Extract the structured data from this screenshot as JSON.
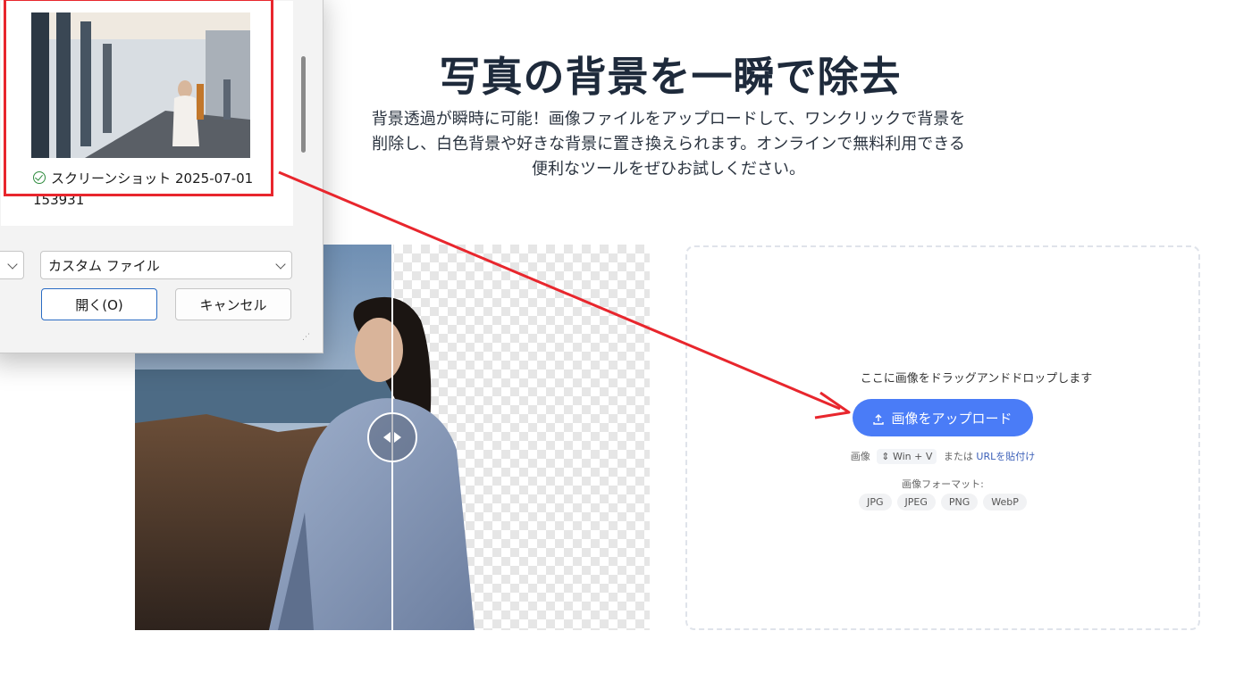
{
  "hero": {
    "title": "写真の背景を一瞬で除去",
    "description": "背景透過が瞬時に可能！画像ファイルをアップロードして、ワンクリックで背景を削除し、白色背景や好きな背景に置き換えられます。オンラインで無料利用できる便利なツールをぜひお試しください。"
  },
  "dropzone": {
    "hint": "ここに画像をドラッグアンドドロップします",
    "upload_button": "画像をアップロード",
    "paste_prefix": "画像",
    "paste_shortcut": "Win + V",
    "paste_or": "または",
    "paste_url": "URLを貼付け",
    "formats_label": "画像フォーマット:",
    "formats": [
      "JPG",
      "JPEG",
      "PNG",
      "WebP"
    ]
  },
  "dialog": {
    "file_name_line1": "スクリーンショット 2025-07-01",
    "file_name_line2": "153931",
    "file_type_filter": "カスタム ファイル",
    "open_button": "開く(O)",
    "cancel_button": "キャンセル"
  },
  "colors": {
    "accent": "#4a7cf7",
    "annotation_red": "#e8262d",
    "title": "#1e2a3b"
  }
}
